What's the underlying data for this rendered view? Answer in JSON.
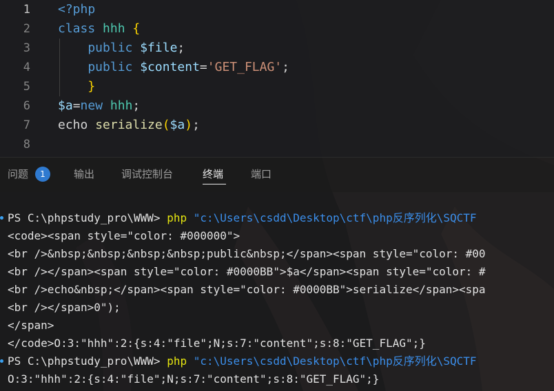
{
  "editor": {
    "lines": [
      {
        "num": "1",
        "tokens": [
          {
            "t": "<?php",
            "c": "t-tag"
          }
        ]
      },
      {
        "num": "2",
        "tokens": [
          {
            "t": "class ",
            "c": "t-kw"
          },
          {
            "t": "hhh ",
            "c": "t-cls"
          },
          {
            "t": "{",
            "c": "t-br"
          }
        ]
      },
      {
        "num": "3",
        "tokens": [
          {
            "t": "    public ",
            "c": "t-kw"
          },
          {
            "t": "$file",
            "c": "t-var"
          },
          {
            "t": ";",
            "c": "t-op"
          }
        ]
      },
      {
        "num": "4",
        "tokens": [
          {
            "t": "    public ",
            "c": "t-kw"
          },
          {
            "t": "$content",
            "c": "t-var"
          },
          {
            "t": "=",
            "c": "t-op"
          },
          {
            "t": "'GET_FLAG'",
            "c": "t-str"
          },
          {
            "t": ";",
            "c": "t-op"
          }
        ]
      },
      {
        "num": "5",
        "tokens": [
          {
            "t": "    }",
            "c": "t-br"
          }
        ]
      },
      {
        "num": "6",
        "tokens": [
          {
            "t": "$a",
            "c": "t-var"
          },
          {
            "t": "=",
            "c": "t-op"
          },
          {
            "t": "new ",
            "c": "t-kw"
          },
          {
            "t": "hhh",
            "c": "t-cls"
          },
          {
            "t": ";",
            "c": "t-op"
          }
        ]
      },
      {
        "num": "7",
        "tokens": [
          {
            "t": "echo ",
            "c": "t-op"
          },
          {
            "t": "serialize",
            "c": "t-fn"
          },
          {
            "t": "(",
            "c": "t-br"
          },
          {
            "t": "$a",
            "c": "t-var"
          },
          {
            "t": ")",
            "c": "t-br"
          },
          {
            "t": ";",
            "c": "t-op"
          }
        ]
      },
      {
        "num": "8",
        "tokens": []
      }
    ]
  },
  "panel": {
    "tabs": {
      "problems": "问题",
      "problems_count": "1",
      "output": "输出",
      "debug_console": "调试控制台",
      "terminal": "终端",
      "ports": "端口"
    }
  },
  "terminal": {
    "prompt1": {
      "ps": "PS C:\\phpstudy_pro\\WWW> ",
      "cmd": "php ",
      "path": "\"c:\\Users\\csdd\\Desktop\\ctf\\php反序列化\\SQCTF"
    },
    "output": [
      "<code><span style=\"color: #000000\">",
      "<br />&nbsp;&nbsp;&nbsp;&nbsp;public&nbsp;</span><span style=\"color: #00",
      "<br /></span><span style=\"color: #0000BB\">$a</span><span style=\"color: #",
      "<br />echo&nbsp;</span><span style=\"color: #0000BB\">serialize</span><spa",
      "<br /></span>0\");",
      "</span>",
      "</code>O:3:\"hhh\":2:{s:4:\"file\";N;s:7:\"content\";s:8:\"GET_FLAG\";}"
    ],
    "prompt2": {
      "ps": "PS C:\\phpstudy_pro\\WWW> ",
      "cmd": "php ",
      "path": "\"c:\\Users\\csdd\\Desktop\\ctf\\php反序列化\\SQCTF"
    },
    "final": "O:3:\"hhh\":2:{s:4:\"file\";N;s:7:\"content\";s:8:\"GET_FLAG\";}"
  }
}
